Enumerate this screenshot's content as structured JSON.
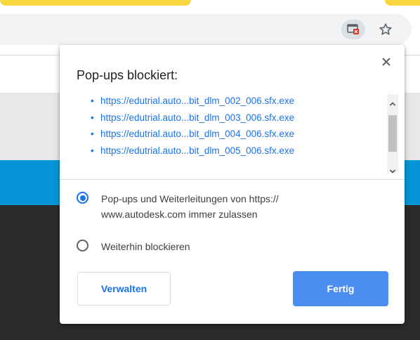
{
  "toolbar": {
    "popup_blocked_icon": "popup-blocked-icon",
    "bookmark_icon": "star-icon"
  },
  "bubble": {
    "title": "Pop-ups blockiert:",
    "close_icon": "close-icon",
    "blocked_links": [
      "https://edutrial.auto...bit_dlm_002_006.sfx.exe",
      "https://edutrial.auto...bit_dlm_003_006.sfx.exe",
      "https://edutrial.auto...bit_dlm_004_006.sfx.exe",
      "https://edutrial.auto...bit_dlm_005_006.sfx.exe"
    ],
    "options": [
      {
        "label": "Pop-ups und Weiterleitungen von https:// www.autodesk.com immer zulassen",
        "checked": true
      },
      {
        "label": "Weiterhin blockieren",
        "checked": false
      }
    ],
    "manage_label": "Verwalten",
    "done_label": "Fertig"
  },
  "colors": {
    "accent": "#1a73e8",
    "done_button": "#4c8ef0",
    "page_blue": "#0696d7",
    "page_dark": "#2b2b2b",
    "tab_yellow": "#f6d73f"
  }
}
